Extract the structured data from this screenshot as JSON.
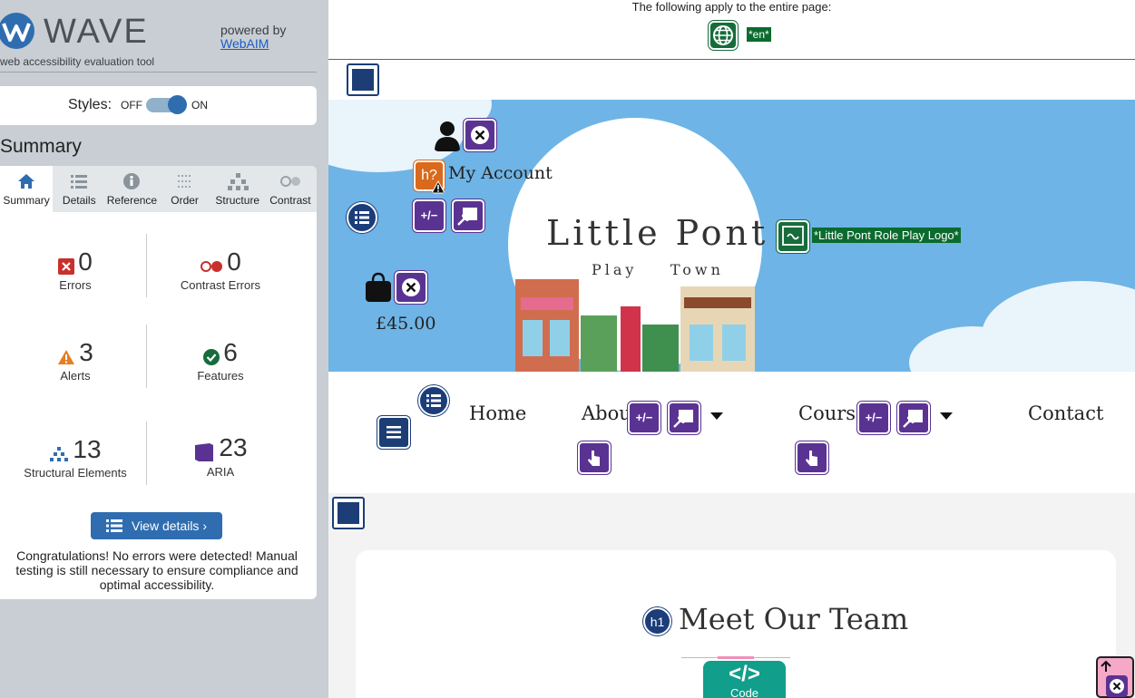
{
  "sidebar": {
    "brand": "WAVE",
    "tagline": "web accessibility evaluation tool",
    "powered_by": "powered by",
    "webaim_link": "WebAIM",
    "styles_label": "Styles:",
    "styles_off": "OFF",
    "styles_on": "ON",
    "summary_heading": "Summary",
    "tabs": [
      {
        "label": "Summary",
        "icon": "home-icon"
      },
      {
        "label": "Details",
        "icon": "list-icon"
      },
      {
        "label": "Reference",
        "icon": "info-icon"
      },
      {
        "label": "Order",
        "icon": "order-icon"
      },
      {
        "label": "Structure",
        "icon": "structure-icon"
      },
      {
        "label": "Contrast",
        "icon": "contrast-icon"
      }
    ],
    "stats": {
      "errors": {
        "count": "0",
        "label": "Errors"
      },
      "contrast_errors": {
        "count": "0",
        "label": "Contrast Errors"
      },
      "alerts": {
        "count": "3",
        "label": "Alerts"
      },
      "features": {
        "count": "6",
        "label": "Features"
      },
      "structural": {
        "count": "13",
        "label": "Structural Elements"
      },
      "aria": {
        "count": "23",
        "label": "ARIA"
      }
    },
    "view_details": "View details ›",
    "congrats": "Congratulations! No errors were detected! Manual testing is still necessary to ensure compliance and optimal accessibility."
  },
  "main": {
    "notice": "The following apply to the entire page:",
    "lang_tag": "*en*",
    "account_label": "My Account",
    "price": "£45.00",
    "brand_big": "Little Pont",
    "brand_play": "Play",
    "brand_town": "Town",
    "logo_alt_tag": "*Little Pont Role Play Logo*",
    "nav": {
      "home": "Home",
      "about": "About",
      "courses": "Courses",
      "contact": "Contact"
    },
    "h1_badge": "h1",
    "heading": "Meet Our Team",
    "code_label": "Code",
    "code_symbol": "</>",
    "aria_expand_symbol": "+/−"
  },
  "colors": {
    "wave_blue": "#2f6db0",
    "aria_purple": "#5a3392",
    "structure_navy": "#1c3d76",
    "feature_green": "#166c3b",
    "error_red": "#c8302c",
    "alert_orange": "#e67e22",
    "hero_sky": "#6eb4e6"
  }
}
